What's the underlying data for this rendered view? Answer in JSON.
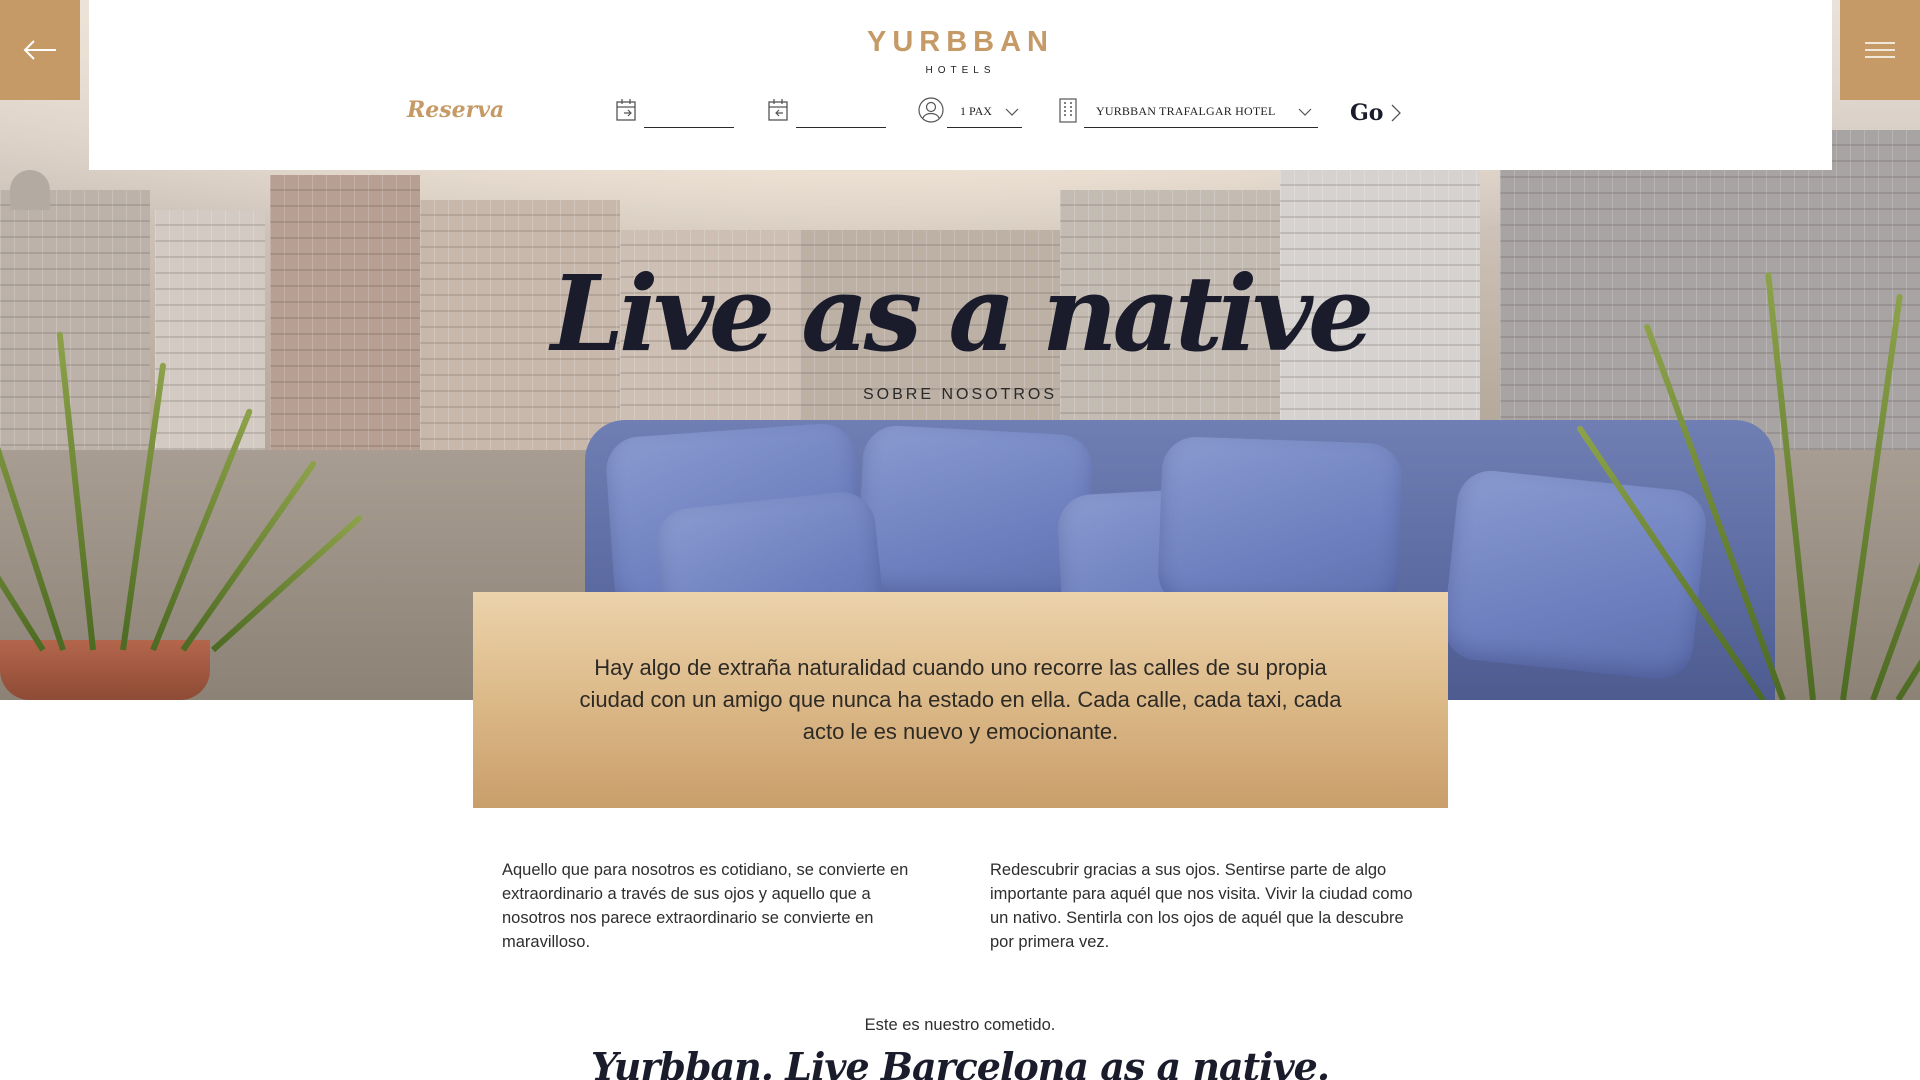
{
  "header": {
    "brand_name": "YURBBAN",
    "brand_sub": "HOTELS",
    "back_icon": "arrow-left-icon",
    "menu_icon": "hamburger-menu-icon"
  },
  "booking": {
    "label": "Reserva",
    "checkin_value": "",
    "checkout_value": "",
    "pax_value": "1 PAX",
    "hotel_value": "YURBBAN TRAFALGAR HOTEL",
    "go_label": "Go"
  },
  "hero": {
    "title": "Live as a native",
    "subtitle": "SOBRE NOSOTROS"
  },
  "intro": {
    "text": "Hay algo de extraña naturalidad cuando uno recorre las calles de su propia ciudad con un amigo que nunca ha estado en ella. Cada calle, cada taxi, cada acto le es nuevo y emocionante."
  },
  "columns": {
    "left": "Aquello que para nosotros es cotidiano, se convierte en extraordinario a través de sus ojos y aquello que a nosotros nos parece extraordinario se convierte en maravilloso.",
    "right": "Redescubrir gracias a sus ojos. Sentirse parte de algo importante para aquél que nos visita. Vivir la ciudad como un nativo. Sentirla con los ojos de aquél que la descubre por primera vez."
  },
  "mission": {
    "text": "Este es nuestro cometido.",
    "tagline": "Yurbban. Live Barcelona as a native."
  },
  "colors": {
    "gold": "#c59a66",
    "navy": "#1a1c2c"
  }
}
